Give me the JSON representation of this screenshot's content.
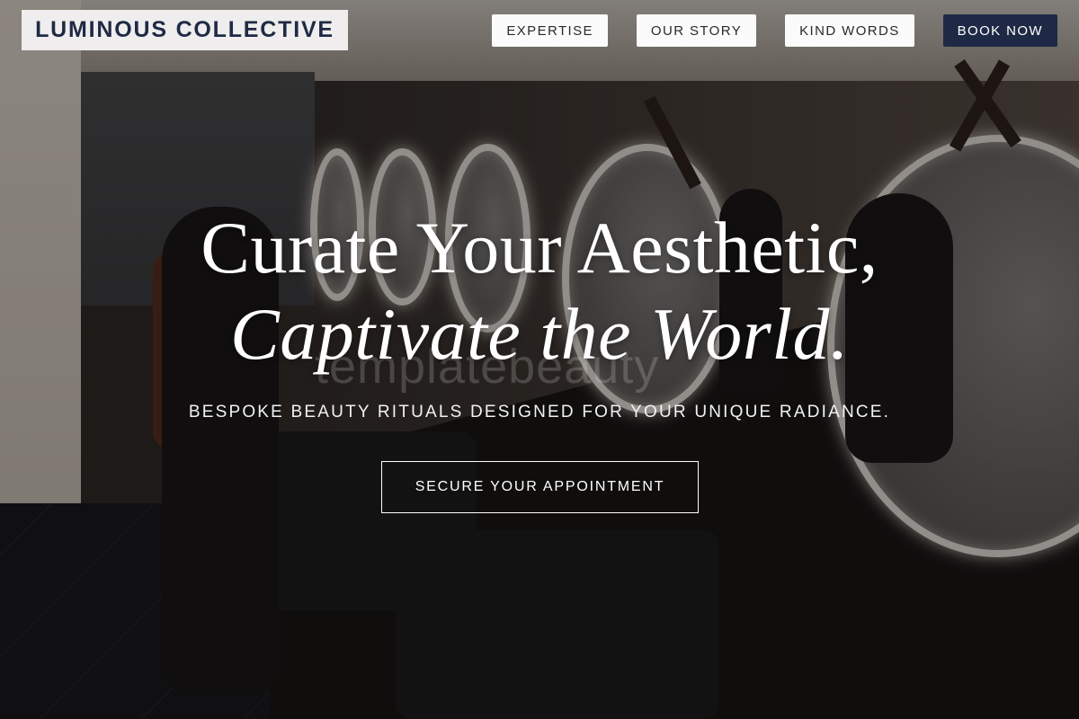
{
  "brand": {
    "name": "LUMINOUS COLLECTIVE"
  },
  "nav": {
    "items": [
      {
        "label": "EXPERTISE"
      },
      {
        "label": "OUR STORY"
      },
      {
        "label": "KIND WORDS"
      },
      {
        "label": "BOOK NOW"
      }
    ]
  },
  "hero": {
    "headline_line1": "Curate Your Aesthetic,",
    "headline_line2": "Captivate the World.",
    "watermark": "templatebeauty",
    "tagline": "BESPOKE BEAUTY RITUALS DESIGNED FOR YOUR UNIQUE RADIANCE.",
    "cta_label": "SECURE YOUR APPOINTMENT"
  },
  "colors": {
    "brand_text": "#1f2a44",
    "cta_background": "#1e2a45",
    "nav_background": "#fbfbfb"
  }
}
